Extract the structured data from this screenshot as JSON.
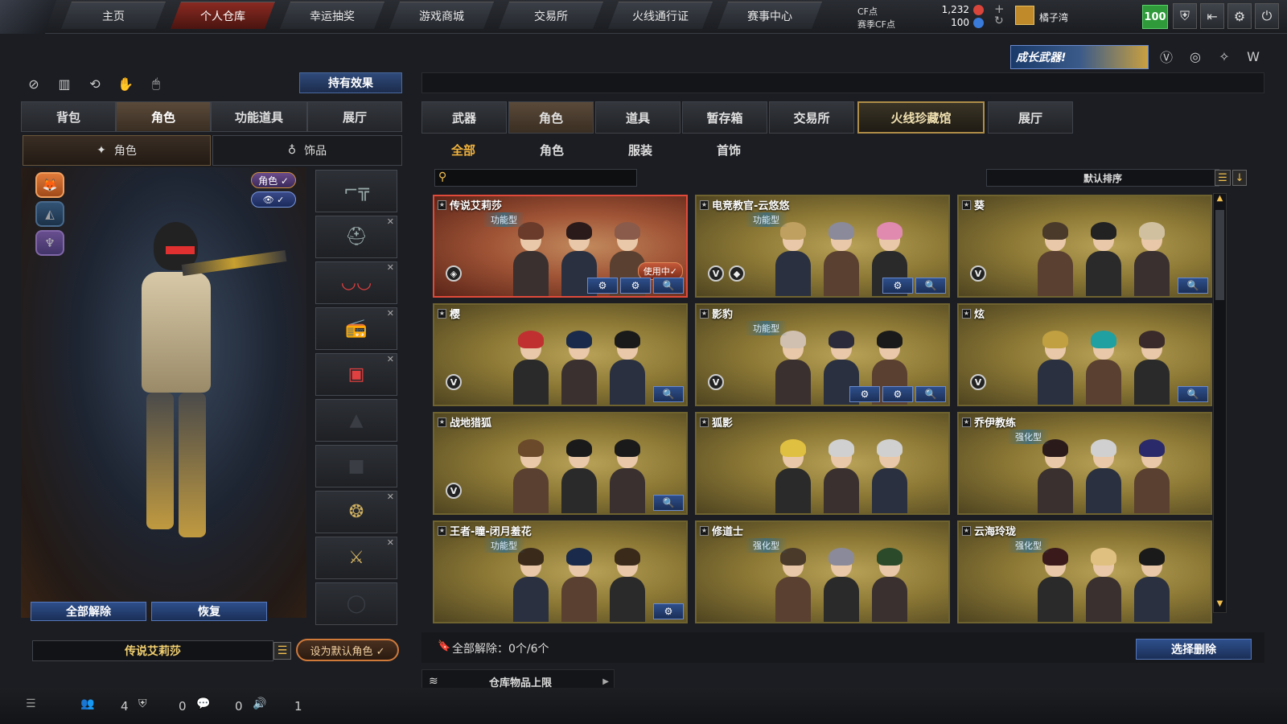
{
  "nav": {
    "tabs": [
      "主页",
      "个人仓库",
      "幸运抽奖",
      "游戏商城",
      "交易所",
      "火线通行证",
      "赛事中心"
    ],
    "active_index": 1
  },
  "currency": {
    "cf_label": "CF点",
    "cf_value": "1,232",
    "season_label": "赛季CF点",
    "season_value": "100"
  },
  "user": {
    "name": "橘子湾",
    "level": "100"
  },
  "promo_banner": "成长武器!",
  "left": {
    "hold_effect_button": "持有效果",
    "tabs": [
      "背包",
      "角色",
      "功能道具",
      "展厅"
    ],
    "active_tab": 1,
    "subtabs": [
      "角色",
      "饰品"
    ],
    "active_subtab": 0,
    "badge_role": "角色 ✓",
    "badge_eye": "👁 ✓",
    "release_all": "全部解除",
    "restore": "恢复",
    "current_character": "传说艾莉莎",
    "set_default": "设为默认角色 ✓"
  },
  "right": {
    "tabs": [
      "武器",
      "角色",
      "道具",
      "暂存箱",
      "交易所",
      "火线珍藏馆",
      "展厅"
    ],
    "active_tab": 1,
    "filters": [
      "全部",
      "角色",
      "服装",
      "首饰"
    ],
    "active_filter": 0,
    "search_placeholder": "",
    "sort_label": "默认排序",
    "cards": [
      {
        "name": "传说艾莉莎",
        "tag": "功能型",
        "in_use": "使用中✓",
        "selected": true,
        "actions": [
          "⚙",
          "⚙",
          "🔍"
        ],
        "badges": [
          "◈"
        ]
      },
      {
        "name": "电竞教官-云悠悠",
        "tag": "功能型",
        "in_use": "",
        "selected": false,
        "actions": [
          "⚙",
          "🔍"
        ],
        "badges": [
          "V",
          "◆"
        ]
      },
      {
        "name": "葵",
        "tag": "",
        "in_use": "",
        "selected": false,
        "actions": [
          "🔍"
        ],
        "badges": [
          "V"
        ]
      },
      {
        "name": "樱",
        "tag": "",
        "in_use": "",
        "selected": false,
        "actions": [
          "🔍"
        ],
        "badges": [
          "V"
        ]
      },
      {
        "name": "影豹",
        "tag": "功能型",
        "in_use": "",
        "selected": false,
        "actions": [
          "⚙",
          "⚙",
          "🔍"
        ],
        "badges": [
          "V"
        ]
      },
      {
        "name": "炫",
        "tag": "",
        "in_use": "",
        "selected": false,
        "actions": [
          "🔍"
        ],
        "badges": [
          "V"
        ]
      },
      {
        "name": "战地猎狐",
        "tag": "",
        "in_use": "",
        "selected": false,
        "actions": [
          "🔍"
        ],
        "badges": [
          "V"
        ]
      },
      {
        "name": "狐影",
        "tag": "",
        "in_use": "",
        "selected": false,
        "actions": [],
        "badges": []
      },
      {
        "name": "乔伊教练",
        "tag": "强化型",
        "in_use": "",
        "selected": false,
        "actions": [],
        "badges": []
      },
      {
        "name": "王者-瞳-闭月羞花",
        "tag": "功能型",
        "in_use": "",
        "selected": false,
        "actions": [
          "⚙"
        ],
        "badges": []
      },
      {
        "name": "修道士",
        "tag": "强化型",
        "in_use": "",
        "selected": false,
        "actions": [],
        "badges": []
      },
      {
        "name": "云海玲珑",
        "tag": "强化型",
        "in_use": "",
        "selected": false,
        "actions": [],
        "badges": []
      }
    ],
    "release_summary": "全部解除：0个/6个",
    "select_delete": "选择删除",
    "warehouse_limit": "仓库物品上限"
  },
  "status": {
    "counts": [
      "4",
      "0",
      "0",
      "1"
    ]
  },
  "colors": {
    "active_nav": "#8a2a22",
    "gold_card": "#b8a157",
    "selected_card_border": "#e04a3a",
    "accent_orange": "#f2b33d"
  }
}
